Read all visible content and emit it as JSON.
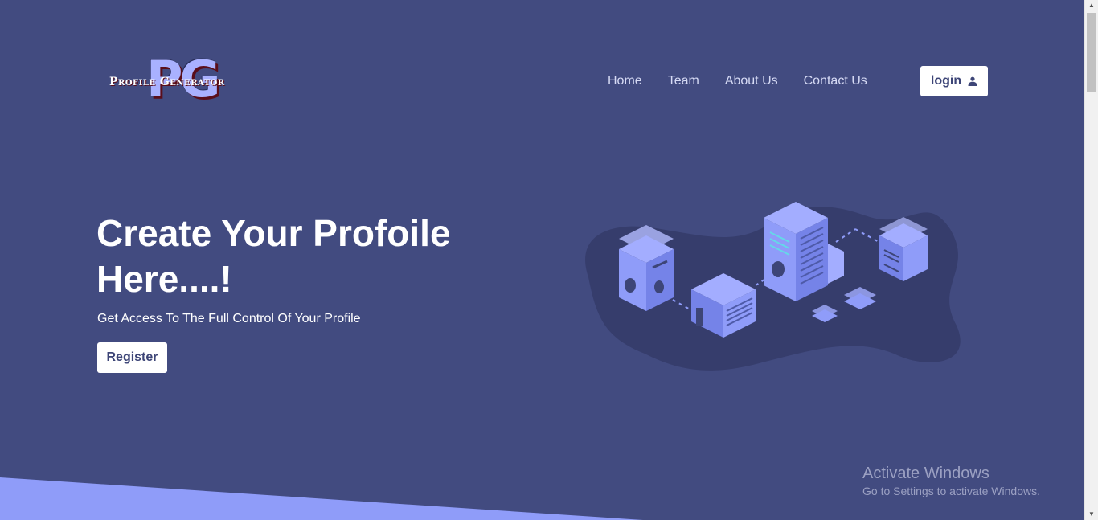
{
  "logo": {
    "monogram": "PG",
    "text": "Profile Generator"
  },
  "nav": {
    "items": [
      {
        "label": "Home"
      },
      {
        "label": "Team"
      },
      {
        "label": "About Us"
      },
      {
        "label": "Contact Us"
      }
    ],
    "login_label": "login",
    "login_icon": "user-icon"
  },
  "hero": {
    "title": "Create Your Profoile Here....!",
    "subtitle": "Get Access To The Full Control Of Your Profile",
    "register_label": "Register"
  },
  "illustration": {
    "icon": "server-network-illustration"
  },
  "watermark": {
    "title": "Activate Windows",
    "subtitle": "Go to Settings to activate Windows."
  },
  "colors": {
    "background": "#424b80",
    "accent": "#8f9cf9",
    "button_bg": "#ffffff",
    "button_text": "#3d4577",
    "nav_text": "#d7dbf5"
  }
}
